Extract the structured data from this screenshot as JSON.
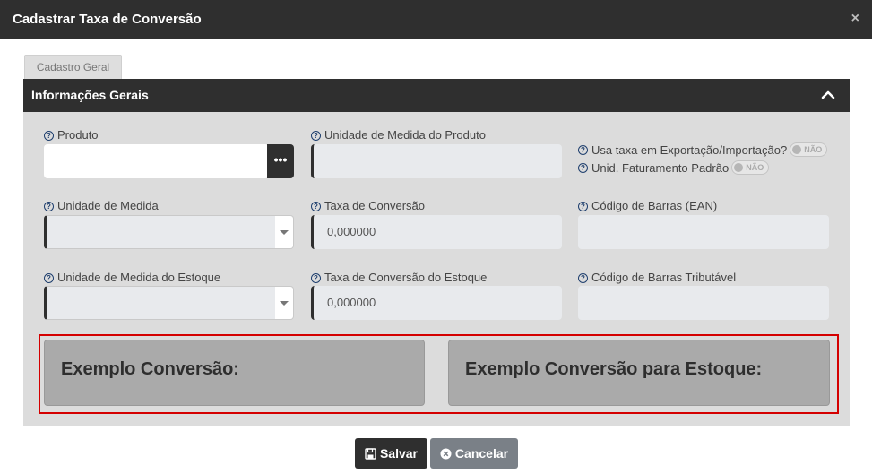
{
  "dialog": {
    "title": "Cadastrar Taxa de Conversão",
    "close_glyph": "×"
  },
  "tabs": [
    {
      "label": "Cadastro Geral",
      "active": true
    }
  ],
  "section": {
    "title": "Informações Gerais",
    "collapse_icon": "chevron-up-icon"
  },
  "fields": {
    "produto": {
      "label": "Produto",
      "value": "",
      "lookup_glyph": "•••"
    },
    "unidade_produto": {
      "label": "Unidade de Medida do Produto",
      "value": ""
    },
    "usa_taxa": {
      "label": "Usa taxa em Exportação/Importação?",
      "toggle_text": "NÃO"
    },
    "unid_faturamento": {
      "label": "Unid. Faturamento Padrão",
      "toggle_text": "NÃO"
    },
    "unidade_medida": {
      "label": "Unidade de Medida",
      "value": ""
    },
    "taxa_conversao": {
      "label": "Taxa de Conversão",
      "value": "0,000000"
    },
    "codigo_barras_ean": {
      "label": "Código de Barras (EAN)",
      "value": ""
    },
    "unidade_estoque": {
      "label": "Unidade de Medida do Estoque",
      "value": ""
    },
    "taxa_conversao_estoque": {
      "label": "Taxa de Conversão do Estoque",
      "value": "0,000000"
    },
    "codigo_barras_tributavel": {
      "label": "Código de Barras Tributável",
      "value": ""
    }
  },
  "examples": {
    "conversao": "Exemplo Conversão:",
    "conversao_estoque": "Exemplo Conversão para Estoque:"
  },
  "footer": {
    "save_label": "Salvar",
    "cancel_label": "Cancelar"
  },
  "help_glyph": "?",
  "colors": {
    "dark": "#2f2f2f",
    "panel": "#dcdcdc",
    "highlight": "#d40000",
    "cancel": "#7a8087"
  }
}
